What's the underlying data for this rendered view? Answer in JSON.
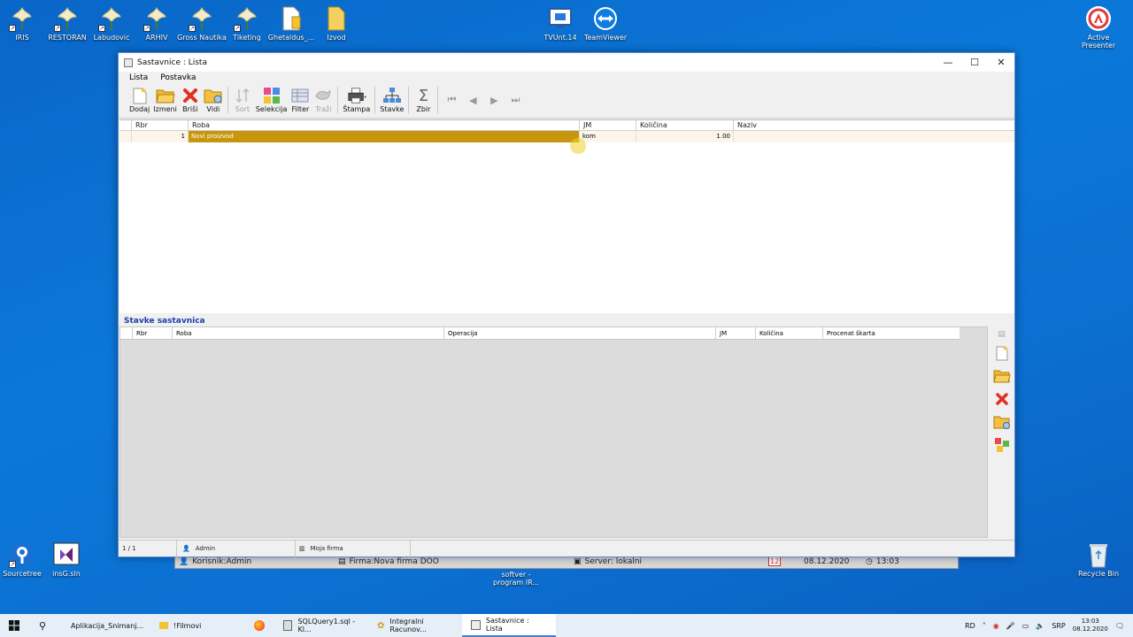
{
  "desktop": {
    "icons_top": [
      {
        "label": "IRIS",
        "icon": "iris-flower-icon"
      },
      {
        "label": "RESTORAN",
        "icon": "iris-flower-icon"
      },
      {
        "label": "Labudovic",
        "icon": "iris-flower-icon"
      },
      {
        "label": "ARHIV",
        "icon": "iris-flower-icon"
      },
      {
        "label": "Gross Nautika",
        "icon": "iris-flower-icon"
      },
      {
        "label": "Tiketing",
        "icon": "iris-flower-icon"
      },
      {
        "label": "Ghetaldus_...",
        "icon": "document-icon"
      },
      {
        "label": "Izvod",
        "icon": "folder-icon"
      }
    ],
    "icons_mid": [
      {
        "label": "TVUnt.14",
        "icon": "computer-icon"
      },
      {
        "label": "TeamViewer",
        "icon": "teamviewer-icon"
      }
    ],
    "active_presenter": "Active Presenter",
    "sourcetree": "Sourcetree",
    "insgsln": "insG.sln",
    "recycle_bin": "Recycle Bin",
    "softver_label": "softver - program IR..."
  },
  "bg_app": {
    "korisnik": "Korisnik:Admin",
    "firma": "Firma:Nova firma DOO",
    "server": "Server: lokalni",
    "cal_day": "12",
    "date": "08.12.2020",
    "time": "13:03"
  },
  "window": {
    "title": "Sastavnice : Lista",
    "menu": [
      "Lista",
      "Postavka"
    ],
    "toolbar": [
      {
        "label": "Dodaj",
        "icon": "new-document-icon",
        "enabled": true
      },
      {
        "label": "Izmeni",
        "icon": "open-folder-icon",
        "enabled": true
      },
      {
        "label": "Briši",
        "icon": "delete-x-icon",
        "enabled": true
      },
      {
        "label": "Vidi",
        "icon": "view-folder-icon",
        "enabled": true
      },
      {
        "label": "Sort",
        "icon": "sort-icon",
        "enabled": false
      },
      {
        "label": "Selekcija",
        "icon": "selection-icon",
        "enabled": true
      },
      {
        "label": "Filter",
        "icon": "filter-icon",
        "enabled": true
      },
      {
        "label": "Traži",
        "icon": "search-hand-icon",
        "enabled": false
      },
      {
        "label": "Štampa",
        "icon": "printer-icon",
        "enabled": true
      },
      {
        "label": "Stavke",
        "icon": "hierarchy-icon",
        "enabled": true
      },
      {
        "label": "Zbir",
        "icon": "sigma-icon",
        "enabled": true
      }
    ],
    "upper_grid": {
      "columns": [
        "Rbr",
        "Roba",
        "JM",
        "Količina",
        "Naziv"
      ],
      "rows": [
        {
          "rbr": "1",
          "roba": "Novi proizvod",
          "jm": "kom",
          "kolicina": "1.00",
          "naziv": ""
        }
      ]
    },
    "lower_section_title": "Stavke sastavnica",
    "lower_grid": {
      "columns": [
        "Rbr",
        "Roba",
        "Operacija",
        "JM",
        "Količina",
        "Procenat škarta"
      ]
    },
    "status": {
      "position": "1 / 1",
      "user": "Admin",
      "company": "Moja firma"
    }
  },
  "taskbar": {
    "items": [
      {
        "label": "Aplikacija_Snimanj...",
        "icon": "folder-icon"
      },
      {
        "label": "!Filmovi",
        "icon": "folder-icon"
      },
      {
        "label": "",
        "icon": "firefox-icon"
      },
      {
        "label": "SQLQuery1.sql - Kl...",
        "icon": "sql-icon"
      },
      {
        "label": "Integralni Racunov...",
        "icon": "app-icon"
      },
      {
        "label": "Sastavnice : Lista",
        "icon": "window-icon"
      }
    ],
    "tray_lang": "RD",
    "tray_kb": "SRP",
    "time": "13:03",
    "date": "08.12.2020"
  },
  "colors": {
    "selected_row": "#c8960c",
    "desktop": "#0b6fd0"
  }
}
